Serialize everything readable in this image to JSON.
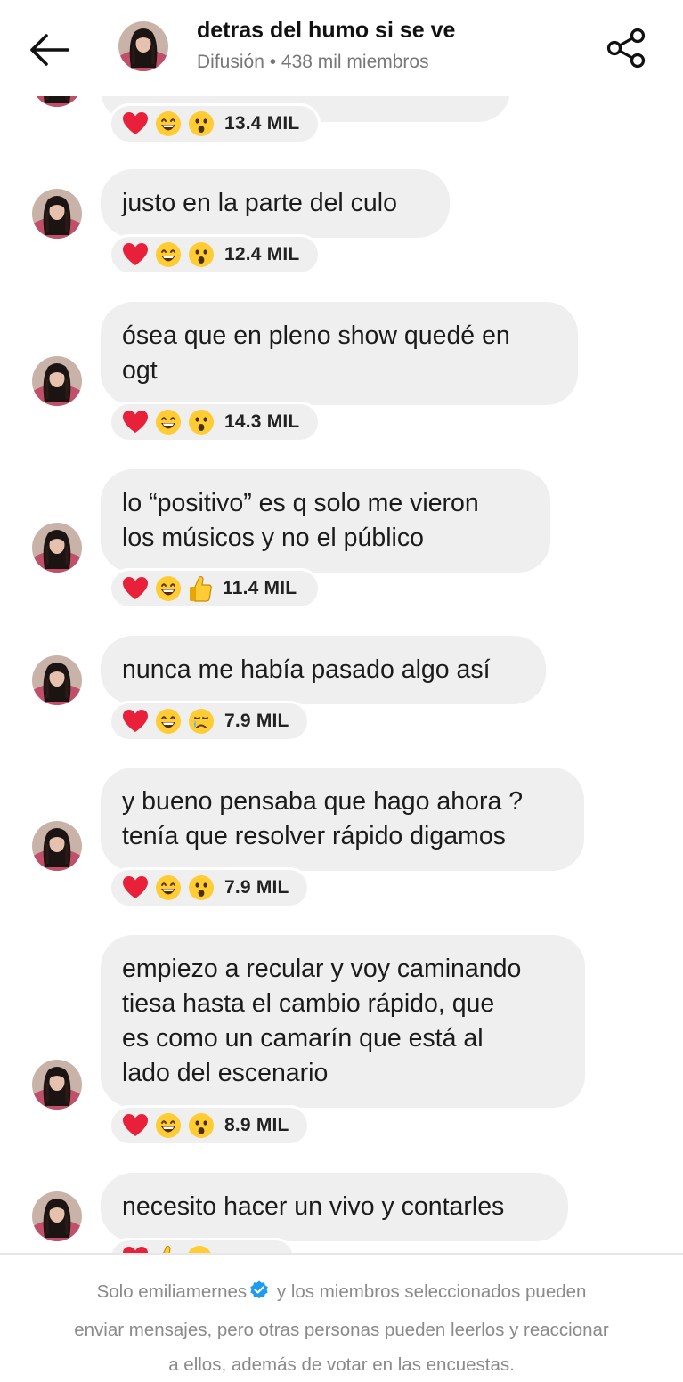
{
  "header": {
    "title": "detras del humo si se ve",
    "subtitle": "Difusión • 438 mil miembros"
  },
  "messages": [
    {
      "lines": [],
      "reactions": [
        "heart",
        "laugh",
        "wow"
      ],
      "count": "13.4 MIL"
    },
    {
      "lines": [
        "justo en la parte del culo"
      ],
      "reactions": [
        "heart",
        "laugh",
        "wow"
      ],
      "count": "12.4 MIL"
    },
    {
      "lines": [
        "ósea que en pleno show quedé en",
        "ogt"
      ],
      "reactions": [
        "heart",
        "laugh",
        "wow"
      ],
      "count": "14.3 MIL"
    },
    {
      "lines": [
        "lo “positivo” es q solo me vieron",
        "los músicos y no el público"
      ],
      "reactions": [
        "heart",
        "laugh",
        "thumbs-up"
      ],
      "count": "11.4 MIL"
    },
    {
      "lines": [
        "nunca me había pasado algo así"
      ],
      "reactions": [
        "heart",
        "laugh",
        "sad-tear"
      ],
      "count": "7.9 MIL"
    },
    {
      "lines": [
        "y bueno pensaba que hago ahora ?",
        "tenía que resolver rápido digamos"
      ],
      "reactions": [
        "heart",
        "laugh",
        "wow"
      ],
      "count": "7.9 MIL"
    },
    {
      "lines": [
        "empiezo a recular y voy caminando",
        "tiesa hasta el cambio rápido, que",
        "es como un camarín que está al",
        "lado del escenario"
      ],
      "reactions": [
        "heart",
        "laugh",
        "wow"
      ],
      "count": "8.9 MIL"
    },
    {
      "lines": [
        "necesito hacer un vivo y contarles"
      ],
      "reactions": [
        "heart",
        "thumbs-up",
        "laugh"
      ],
      "count": ""
    }
  ],
  "footer": {
    "line1_before": "Solo emiliamernes",
    "line1_after": " y los miembros seleccionados pueden",
    "line2": "enviar mensajes, pero otras personas pueden leerlos y reaccionar",
    "line3": "a ellos, además de votar en las encuestas."
  },
  "colors": {
    "bubble": "#efefef",
    "heart": "#e8203a",
    "emoji_yellow": "#ffcc33",
    "verified": "#1d9bf0",
    "muted_text": "#8a8a8a"
  }
}
